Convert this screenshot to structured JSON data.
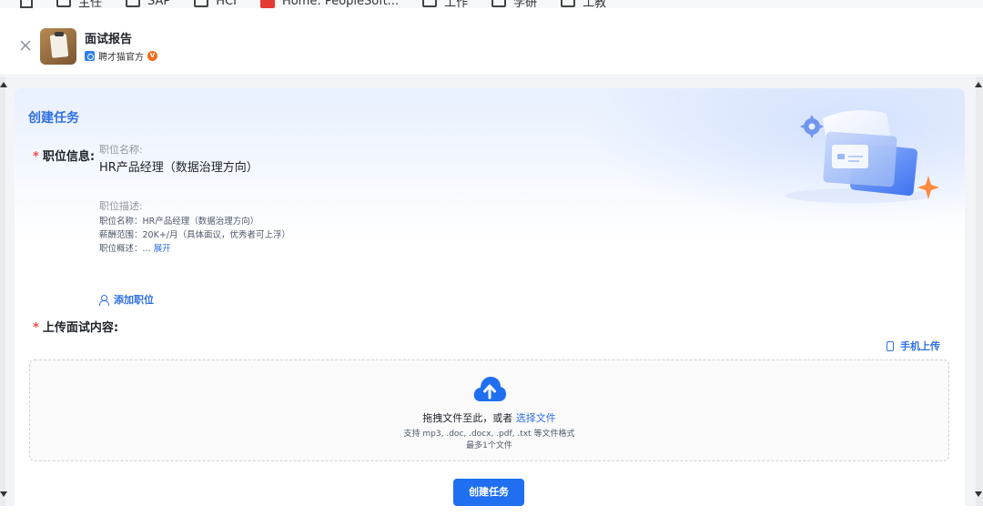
{
  "bookmarks": {
    "items": [
      "主任",
      "SAP",
      "HCI",
      "Home: PeopleSoft...",
      "工作",
      "学研",
      "工教"
    ]
  },
  "header": {
    "app_title": "面试报告",
    "publisher": "聘才猫官方",
    "verified_badge": "V"
  },
  "panel": {
    "title": "创建任务",
    "position_info": {
      "label": "职位信息:",
      "name_label": "职位名称:",
      "name_value": "HR产品经理（数据治理方向）",
      "desc_label": "职位描述:",
      "desc_lines": [
        "职位名称：HR产品经理（数据治理方向）",
        "薪酬范围：20K+/月（具体面议，优秀者可上浮）",
        "职位概述：... "
      ],
      "expand_label": "展开",
      "add_position_label": "添加职位"
    },
    "upload": {
      "label": "上传面试内容:",
      "mobile_upload_label": "手机上传",
      "drop_text": "拖拽文件至此，或者 ",
      "select_file_label": "选择文件",
      "formats_hint": "支持 mp3, .doc, .docx, .pdf, .txt 等文件格式",
      "limit_hint": "最多1个文件"
    },
    "create_button_label": "创建任务"
  },
  "colors": {
    "accent": "#2f6fe4",
    "button": "#1f6ff0",
    "required": "#f54a45"
  }
}
